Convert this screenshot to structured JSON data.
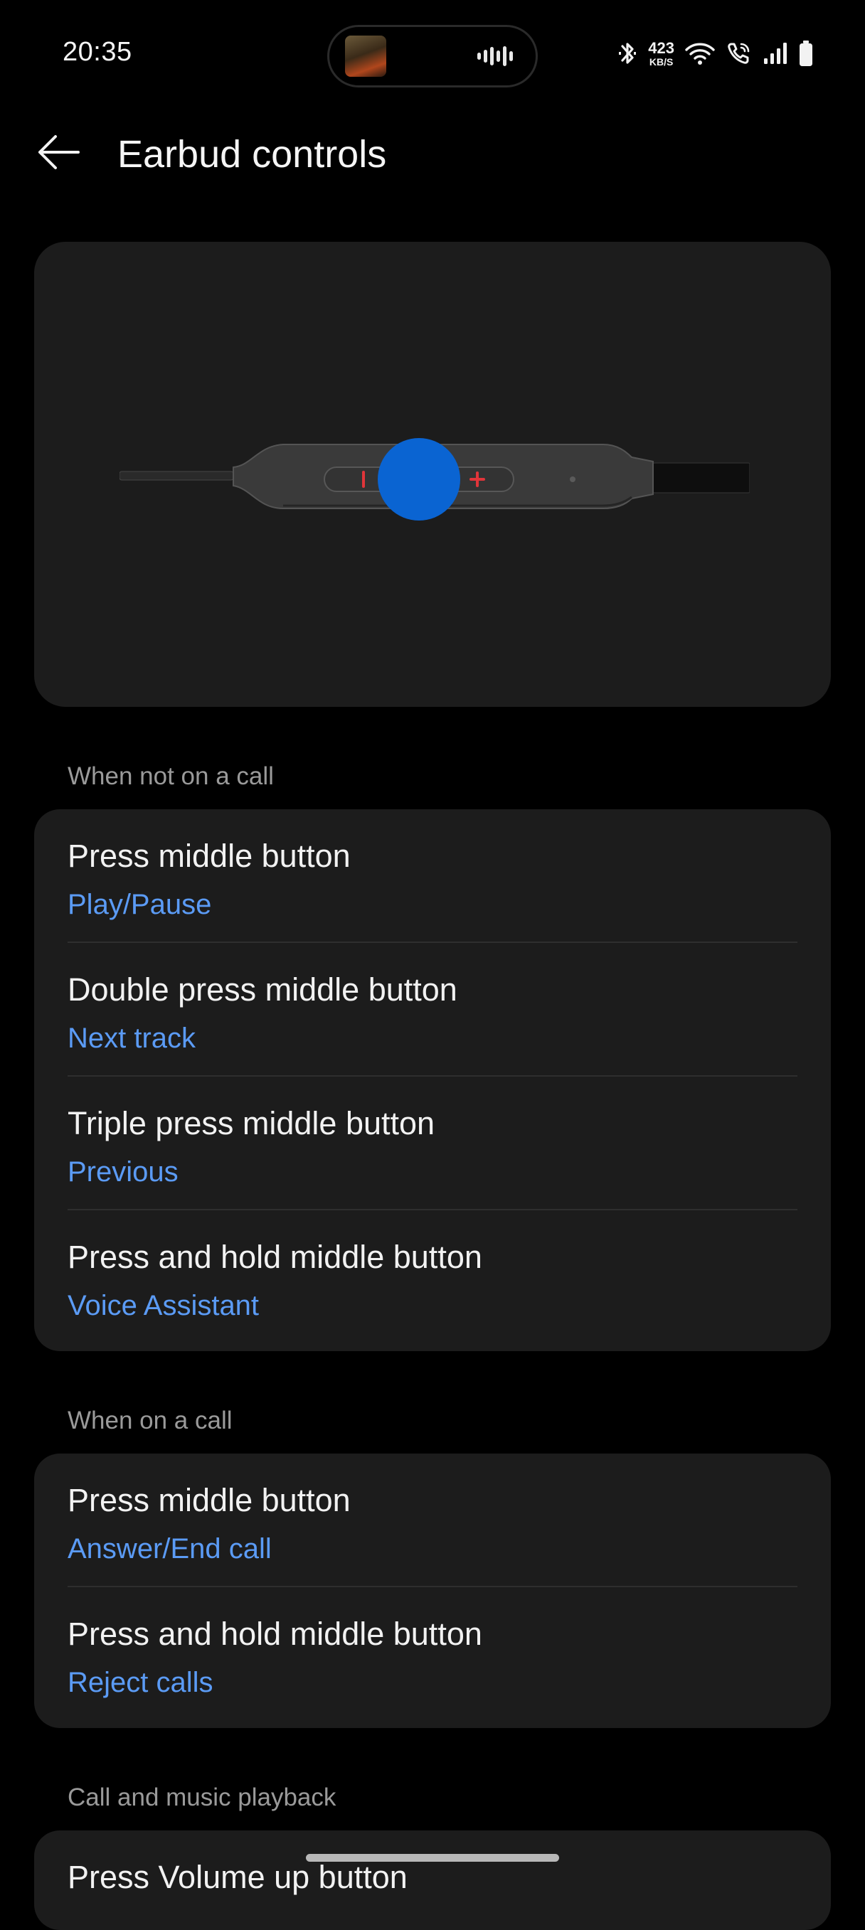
{
  "status_bar": {
    "time": "20:35",
    "network_speed": "423",
    "network_speed_unit": "KB/S",
    "icons": [
      "media-art-icon",
      "audio-wave-icon",
      "bluetooth-icon",
      "network-speed-indicator",
      "wifi-icon",
      "wifi-calling-icon",
      "signal-icon",
      "battery-icon"
    ]
  },
  "header": {
    "back_icon": "back-arrow-icon",
    "title": "Earbud controls"
  },
  "hero": {
    "image": "inline-remote-illustration",
    "minus_symbol": "−",
    "plus_symbol": "+",
    "colors": {
      "card": "#1c1c1c",
      "remote_body": "#3a3a3a",
      "highlight": "#0a64d2",
      "symbol": "#e0353a"
    }
  },
  "sections": [
    {
      "label": "When not on a call",
      "items": [
        {
          "title": "Press middle button",
          "value": "Play/Pause"
        },
        {
          "title": "Double press middle button",
          "value": "Next track"
        },
        {
          "title": "Triple press middle button",
          "value": "Previous"
        },
        {
          "title": "Press and hold middle button",
          "value": "Voice Assistant"
        }
      ]
    },
    {
      "label": "When on a call",
      "items": [
        {
          "title": "Press middle button",
          "value": "Answer/End call"
        },
        {
          "title": "Press and hold middle button",
          "value": "Reject calls"
        }
      ]
    },
    {
      "label": "Call and music playback",
      "items": [
        {
          "title": "Press Volume up button",
          "value": ""
        }
      ]
    }
  ],
  "colors": {
    "background": "#000000",
    "card": "#1c1c1c",
    "accent": "#5b9bf5",
    "section_label": "#9a9a9a",
    "divider": "#2e2e2e"
  }
}
